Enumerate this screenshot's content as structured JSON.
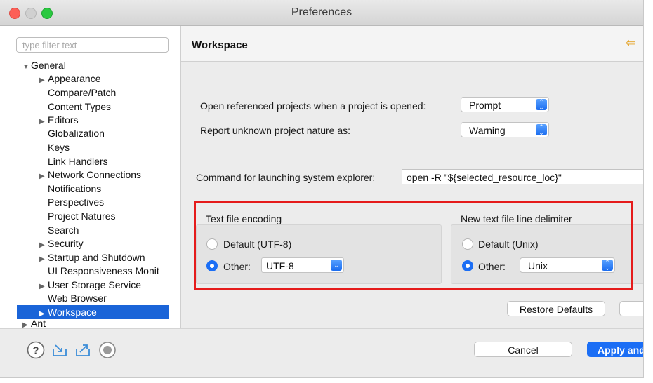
{
  "window": {
    "title": "Preferences"
  },
  "sidebar": {
    "filter_placeholder": "type filter text",
    "items": [
      {
        "label": "General",
        "twisty": "▼"
      },
      {
        "label": "Appearance",
        "twisty": "▶"
      },
      {
        "label": "Compare/Patch",
        "twisty": ""
      },
      {
        "label": "Content Types",
        "twisty": ""
      },
      {
        "label": "Editors",
        "twisty": "▶"
      },
      {
        "label": "Globalization",
        "twisty": ""
      },
      {
        "label": "Keys",
        "twisty": ""
      },
      {
        "label": "Link Handlers",
        "twisty": ""
      },
      {
        "label": "Network Connections",
        "twisty": "▶"
      },
      {
        "label": "Notifications",
        "twisty": ""
      },
      {
        "label": "Perspectives",
        "twisty": ""
      },
      {
        "label": "Project Natures",
        "twisty": ""
      },
      {
        "label": "Search",
        "twisty": ""
      },
      {
        "label": "Security",
        "twisty": "▶"
      },
      {
        "label": "Startup and Shutdown",
        "twisty": "▶"
      },
      {
        "label": "UI Responsiveness Monit",
        "twisty": ""
      },
      {
        "label": "User Storage Service",
        "twisty": "▶"
      },
      {
        "label": "Web Browser",
        "twisty": ""
      },
      {
        "label": "Workspace",
        "twisty": "▶"
      },
      {
        "label": "Ant",
        "twisty": "▶"
      }
    ],
    "selected": "Workspace"
  },
  "page": {
    "title": "Workspace",
    "back_icon": "back-arrow-icon",
    "open_referenced_label": "Open referenced projects when a project is opened:",
    "open_referenced_value": "Prompt",
    "report_unknown_label": "Report unknown project nature as:",
    "report_unknown_value": "Warning",
    "command_label": "Command for launching system explorer:",
    "command_value": "open -R \"${selected_resource_loc}\"",
    "encoding": {
      "title": "Text file encoding",
      "default_label": "Default (UTF-8)",
      "other_label": "Other:",
      "other_value": "UTF-8"
    },
    "line_delimiter": {
      "title": "New text file line delimiter",
      "default_label": "Default (Unix)",
      "other_label": "Other:",
      "other_value": "Unix"
    },
    "restore_defaults": "Restore Defaults"
  },
  "footer": {
    "icons": [
      "help-icon",
      "import-icon",
      "export-icon",
      "record-icon"
    ],
    "cancel": "Cancel",
    "apply": "Apply and"
  },
  "colors": {
    "accent": "#1b6ef5",
    "selection": "#1a64d8",
    "highlight_frame": "#e51b1b",
    "back_arrow": "#e3a020"
  }
}
